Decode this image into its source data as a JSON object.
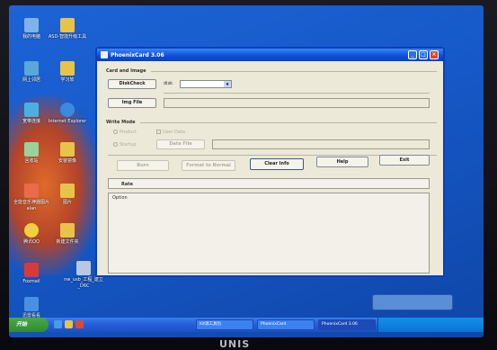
{
  "window": {
    "title": "PhoenixCard 3.06"
  },
  "card_image": {
    "group_label": "Card and Image",
    "diskcheck_label": "DiskCheck",
    "disk_label": "disk",
    "disk_value": "",
    "imgfile_label": "Img File",
    "img_path": ""
  },
  "write_mode": {
    "group_label": "Write Mode",
    "product_label": "Product",
    "startup_label": "Startup",
    "user_data_label": "User Data",
    "data_file_label": "Data File"
  },
  "actions": {
    "burn_label": "Burn",
    "format_label": "Format to Normal",
    "clear_label": "Clear Info",
    "help_label": "Help",
    "exit_label": "Exit"
  },
  "log": {
    "rate_label": "Rate",
    "option_label": "Option"
  },
  "desktop_icons": [
    {
      "label": "我的电脑",
      "color": "#7fb2e8"
    },
    {
      "label": "ASD-智能升级工具",
      "color": "#e8c34a"
    },
    {
      "label": "网上邻居",
      "color": "#5aa7d8"
    },
    {
      "label": "学习软",
      "color": "#e8c34a"
    },
    {
      "label": "宽带连接",
      "color": "#4bb0e0"
    },
    {
      "label": "Internet Explorer",
      "color": "#3a8be0"
    },
    {
      "label": "回收站",
      "color": "#9ad29a"
    },
    {
      "label": "安装镜像",
      "color": "#e8c34a"
    },
    {
      "label": "全能音乐神器图片 alan",
      "color": "#e86b4a"
    },
    {
      "label": "图片",
      "color": "#e8c34a"
    },
    {
      "label": "腾讯QQ",
      "color": "#f0d040"
    },
    {
      "label": "新建文件夹",
      "color": "#e8c34a"
    },
    {
      "label": "Foxmail",
      "color": "#d83a3a"
    },
    {
      "label": "nw_usb_工程_建立_D6C",
      "color": "#b8c8e0"
    },
    {
      "label": "迅雷看看",
      "color": "#4a90e0"
    }
  ],
  "taskbar": {
    "start_label": "开始",
    "tasks": [
      "Kit源工具包",
      "PhoenixCard",
      "PhoenixCard 3.06"
    ]
  },
  "monitor": {
    "brand": "UNIS"
  }
}
